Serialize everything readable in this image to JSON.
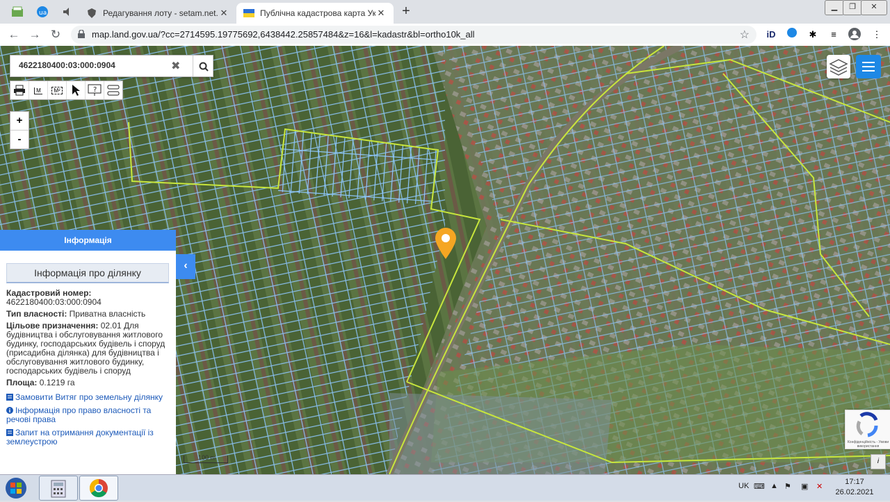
{
  "browser": {
    "tabs": [
      {
        "title": "Редагування лоту - setam.net.ua",
        "close": "✕"
      },
      {
        "title": "Публічна кадастрова карта Укр",
        "close": "✕"
      }
    ],
    "new_tab": "+",
    "url": "map.land.gov.ua/?cc=2714595.19775692,6438442.25857484&z=16&l=kadastr&bl=ortho10k_all"
  },
  "map": {
    "search_value": "4622180400:03:000:0904",
    "clear": "✖",
    "tools": [
      "print-icon",
      "measure-line-icon",
      "measure-area-icon",
      "cursor-icon",
      "info-icon",
      "route-icon"
    ],
    "tool_labels": {
      "measure_line": "M",
      "measure_area": "M²"
    },
    "zoom_in": "+",
    "zoom_out": "-",
    "scale_label": "100 m",
    "info_btn": "i"
  },
  "panel": {
    "header": "Інформація",
    "subheader": "Інформація про ділянку",
    "cadastral_label": "Кадастровий номер:",
    "cadastral_value": "4622180400:03:000:0904",
    "ownership_label": "Тип власності:",
    "ownership_value": "Приватна власність",
    "purpose_label": "Цільове призначення:",
    "purpose_value": "02.01 Для будівництва і обслуговування житлового будинку, господарських будівель і споруд (присадибна ділянка) для будівництва і обслуговування житлового будинку, господарських будівель і споруд",
    "area_label": "Площа:",
    "area_value": "0.1219 га",
    "links": [
      "Замовити Витяг про земельну ділянку",
      "Інформація про право власності та речові права",
      "Запит на отримання документації із землеустрою"
    ],
    "collapse": "‹"
  },
  "recaptcha": {
    "text": "Конфіденційність - Умови використання"
  },
  "taskbar": {
    "lang": "UK",
    "time": "17:17",
    "date": "26.02.2021"
  },
  "colors": {
    "accent": "#3d8bf0",
    "parcel_stroke": "#8ec8ff",
    "boundary": "#c8e63c",
    "marker": "#f5a623"
  }
}
